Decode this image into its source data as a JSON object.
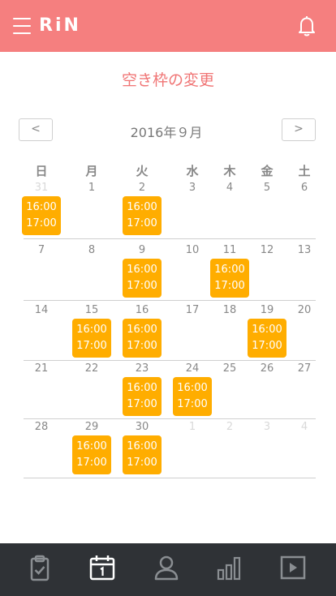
{
  "header": {
    "logo": "RiN"
  },
  "page": {
    "title": "空き枠の変更"
  },
  "calendar": {
    "month_label": "2016年９月",
    "prev_label": "<",
    "next_label": ">",
    "weekdays": [
      "日",
      "月",
      "火",
      "水",
      "木",
      "金",
      "土"
    ],
    "weeks": [
      [
        {
          "d": "31",
          "other": true,
          "slot": {
            "start": "16:00",
            "end": "17:00"
          }
        },
        {
          "d": "1"
        },
        {
          "d": "2",
          "slot": {
            "start": "16:00",
            "end": "17:00"
          }
        },
        {
          "d": "3"
        },
        {
          "d": "4"
        },
        {
          "d": "5"
        },
        {
          "d": "6"
        }
      ],
      [
        {
          "d": "7"
        },
        {
          "d": "8"
        },
        {
          "d": "9",
          "slot": {
            "start": "16:00",
            "end": "17:00"
          }
        },
        {
          "d": "10"
        },
        {
          "d": "11",
          "slot": {
            "start": "16:00",
            "end": "17:00"
          }
        },
        {
          "d": "12"
        },
        {
          "d": "13"
        }
      ],
      [
        {
          "d": "14"
        },
        {
          "d": "15",
          "slot": {
            "start": "16:00",
            "end": "17:00"
          }
        },
        {
          "d": "16",
          "slot": {
            "start": "16:00",
            "end": "17:00"
          }
        },
        {
          "d": "17"
        },
        {
          "d": "18"
        },
        {
          "d": "19",
          "slot": {
            "start": "16:00",
            "end": "17:00"
          }
        },
        {
          "d": "20"
        }
      ],
      [
        {
          "d": "21"
        },
        {
          "d": "22"
        },
        {
          "d": "23",
          "slot": {
            "start": "16:00",
            "end": "17:00"
          }
        },
        {
          "d": "24",
          "slot": {
            "start": "16:00",
            "end": "17:00"
          }
        },
        {
          "d": "25"
        },
        {
          "d": "26"
        },
        {
          "d": "27"
        }
      ],
      [
        {
          "d": "28"
        },
        {
          "d": "29",
          "slot": {
            "start": "16:00",
            "end": "17:00"
          }
        },
        {
          "d": "30",
          "slot": {
            "start": "16:00",
            "end": "17:00"
          }
        },
        {
          "d": "1",
          "other": true
        },
        {
          "d": "2",
          "other": true
        },
        {
          "d": "3",
          "other": true
        },
        {
          "d": "4",
          "other": true
        }
      ]
    ]
  },
  "tabbar": {
    "items": [
      {
        "icon": "clipboard-check-icon",
        "active": false
      },
      {
        "icon": "calendar-icon",
        "active": true
      },
      {
        "icon": "user-icon",
        "active": false
      },
      {
        "icon": "bar-chart-icon",
        "active": false
      },
      {
        "icon": "play-icon",
        "active": false
      }
    ]
  },
  "colors": {
    "header": "#f57f7f",
    "title": "#f07575",
    "slot": "#ffad00",
    "tabbar": "#2f3236",
    "tab_icon": "#8a8e92",
    "tab_icon_active": "#ffffff"
  }
}
